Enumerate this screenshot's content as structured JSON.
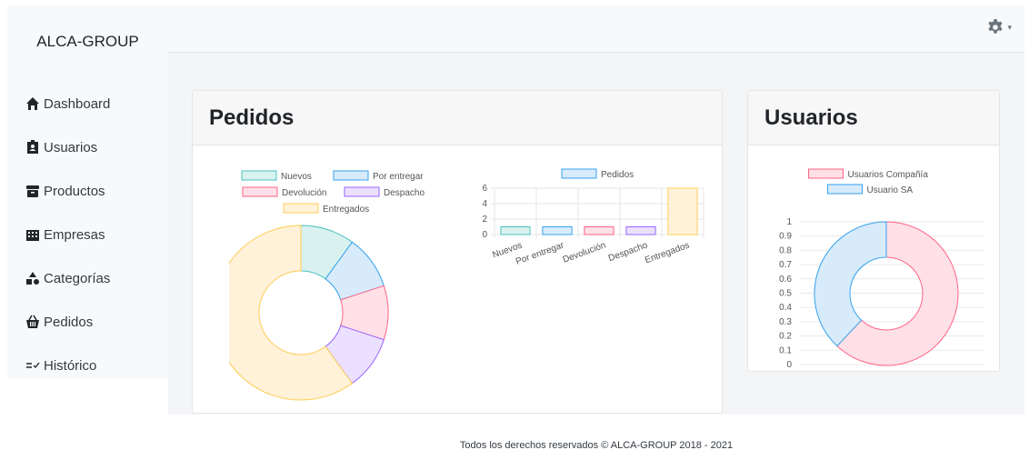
{
  "brand": "ALCA-GROUP",
  "sidebar": {
    "items": [
      {
        "label": "Dashboard",
        "icon": "home-icon"
      },
      {
        "label": "Usuarios",
        "icon": "id-badge-icon"
      },
      {
        "label": "Productos",
        "icon": "archive-box-icon"
      },
      {
        "label": "Empresas",
        "icon": "building-icon"
      },
      {
        "label": "Categorías",
        "icon": "shapes-icon"
      },
      {
        "label": "Pedidos",
        "icon": "shopping-basket-icon"
      },
      {
        "label": "Histórico",
        "icon": "list-check-icon"
      }
    ]
  },
  "topbar": {
    "settings_icon": "gear-icon",
    "caret": "▾"
  },
  "cards": {
    "pedidos": {
      "title": "Pedidos"
    },
    "usuarios": {
      "title": "Usuarios"
    }
  },
  "footer": "Todos los derechos reservados © ALCA-GROUP 2018 - 2021",
  "colors": {
    "Nuevos": {
      "fill": "#d9f2ef",
      "stroke": "#4bc0c0"
    },
    "Por entregar": {
      "fill": "#d7ebfb",
      "stroke": "#36a2eb"
    },
    "Devolución": {
      "fill": "#ffe0e6",
      "stroke": "#ff6384"
    },
    "Despacho": {
      "fill": "#ebe0ff",
      "stroke": "#9966ff"
    },
    "Entregados": {
      "fill": "#fff2d9",
      "stroke": "#ffcd56"
    }
  },
  "chart_data": [
    {
      "type": "pie",
      "variant": "doughnut",
      "categories": [
        "Nuevos",
        "Por entregar",
        "Devolución",
        "Despacho",
        "Entregados"
      ],
      "values": [
        1,
        1,
        1,
        1,
        6
      ]
    },
    {
      "type": "bar",
      "categories": [
        "Nuevos",
        "Por entregar",
        "Devolución",
        "Despacho",
        "Entregados"
      ],
      "series": [
        {
          "name": "Pedidos",
          "values": [
            1,
            1,
            1,
            1,
            6
          ]
        }
      ],
      "ylim": [
        0,
        6
      ],
      "yticks": [
        0,
        2,
        4,
        6
      ],
      "grid": true,
      "legend": "top",
      "bar_colors": [
        "Nuevos",
        "Por entregar",
        "Devolución",
        "Despacho",
        "Entregados"
      ]
    },
    {
      "type": "pie",
      "variant": "doughnut",
      "categories": [
        "Usuarios Compañía",
        "Usuario SA"
      ],
      "values": [
        0.62,
        0.38
      ],
      "colors": [
        {
          "fill": "#ffe0e6",
          "stroke": "#ff6384"
        },
        {
          "fill": "#d7ebfb",
          "stroke": "#36a2eb"
        }
      ],
      "scale_ticks": [
        "0",
        "0.1",
        "0.2",
        "0.3",
        "0.4",
        "0.5",
        "0.6",
        "0.7",
        "0.8",
        "0.9",
        "1"
      ],
      "legend": "top"
    }
  ]
}
